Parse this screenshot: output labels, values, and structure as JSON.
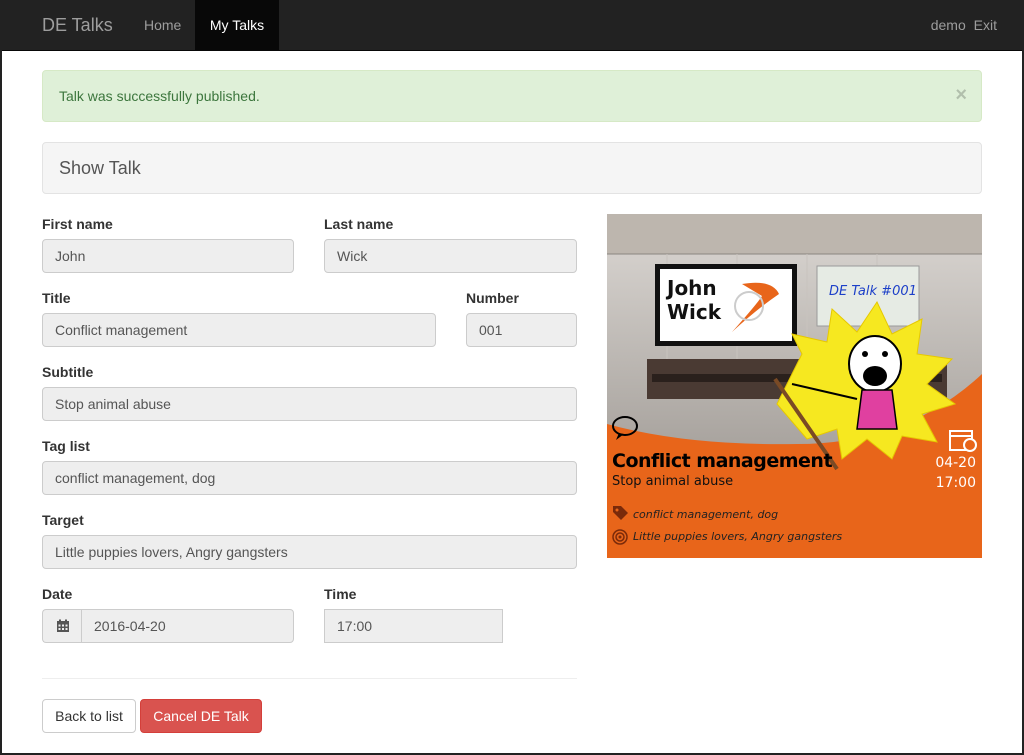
{
  "navbar": {
    "brand": "DE Talks",
    "links": [
      {
        "label": "Home",
        "active": false
      },
      {
        "label": "My Talks",
        "active": true
      }
    ],
    "user": "demo",
    "exit": "Exit"
  },
  "alert": {
    "message": "Talk was successfully published.",
    "close": "×"
  },
  "panel": {
    "title": "Show Talk"
  },
  "form": {
    "first_name": {
      "label": "First name",
      "value": "John"
    },
    "last_name": {
      "label": "Last name",
      "value": "Wick"
    },
    "title": {
      "label": "Title",
      "value": "Conflict management"
    },
    "number": {
      "label": "Number",
      "value": "001"
    },
    "subtitle": {
      "label": "Subtitle",
      "value": "Stop animal abuse"
    },
    "tag_list": {
      "label": "Tag list",
      "value": "conflict management, dog"
    },
    "target": {
      "label": "Target",
      "value": "Little puppies lovers, Angry gangsters"
    },
    "date": {
      "label": "Date",
      "value": "2016-04-20"
    },
    "time": {
      "label": "Time",
      "value": "17:00"
    }
  },
  "buttons": {
    "back": "Back to list",
    "cancel": "Cancel DE Talk"
  },
  "poster": {
    "screen_name_line1": "John",
    "screen_name_line2": "Wick",
    "board_text": "DE Talk #001",
    "title": "Conflict management",
    "subtitle": "Stop animal abuse",
    "date": "04-20",
    "time": "17:00",
    "tags": "conflict management, dog",
    "target": "Little puppies lovers, Angry gangsters",
    "accent_color": "#e8651a"
  }
}
